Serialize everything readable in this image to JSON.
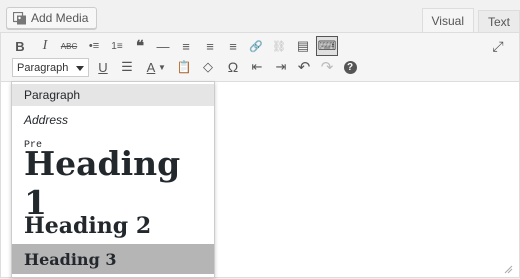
{
  "media": {
    "add_media_label": "Add Media"
  },
  "tabs": [
    {
      "label": "Visual",
      "active": true
    },
    {
      "label": "Text",
      "active": false
    }
  ],
  "toolbar": {
    "row1": [
      {
        "name": "bold",
        "glyph": "B"
      },
      {
        "name": "italic",
        "glyph": "I"
      },
      {
        "name": "strikethrough",
        "glyph": "ABC"
      },
      {
        "name": "bulleted-list",
        "glyph": "•≡"
      },
      {
        "name": "numbered-list",
        "glyph": "1≡"
      },
      {
        "name": "blockquote",
        "glyph": "❝"
      },
      {
        "name": "horizontal-line",
        "glyph": "—"
      },
      {
        "name": "align-left",
        "glyph": "≡"
      },
      {
        "name": "align-center",
        "glyph": "≡"
      },
      {
        "name": "align-right",
        "glyph": "≡"
      },
      {
        "name": "insert-link",
        "glyph": "🔗"
      },
      {
        "name": "remove-link",
        "glyph": "⛓"
      },
      {
        "name": "read-more",
        "glyph": "▤"
      },
      {
        "name": "toolbar-toggle",
        "glyph": "⌨"
      },
      {
        "name": "fullscreen",
        "glyph": "⤢"
      }
    ],
    "format_select": {
      "selected": "Paragraph"
    },
    "row2": [
      {
        "name": "underline",
        "glyph": "U"
      },
      {
        "name": "justify",
        "glyph": "☰"
      },
      {
        "name": "text-color",
        "glyph": "A"
      },
      {
        "name": "paste-as-text",
        "glyph": "📋"
      },
      {
        "name": "clear-formatting",
        "glyph": "◇"
      },
      {
        "name": "special-character",
        "glyph": "Ω"
      },
      {
        "name": "decrease-indent",
        "glyph": "⇤"
      },
      {
        "name": "increase-indent",
        "glyph": "⇥"
      },
      {
        "name": "undo",
        "glyph": "↶"
      },
      {
        "name": "redo",
        "glyph": "↷"
      },
      {
        "name": "help",
        "glyph": "?"
      }
    ]
  },
  "format_dropdown": {
    "options": [
      "Paragraph",
      "Address",
      "Pre",
      "Heading 1",
      "Heading 2",
      "Heading 3"
    ],
    "hovered": "Paragraph",
    "highlighted": "Heading 3"
  },
  "colors": {
    "toolbar_bg": "#f5f5f5",
    "border": "#dddddd",
    "highlight": "#b5b5b5"
  }
}
